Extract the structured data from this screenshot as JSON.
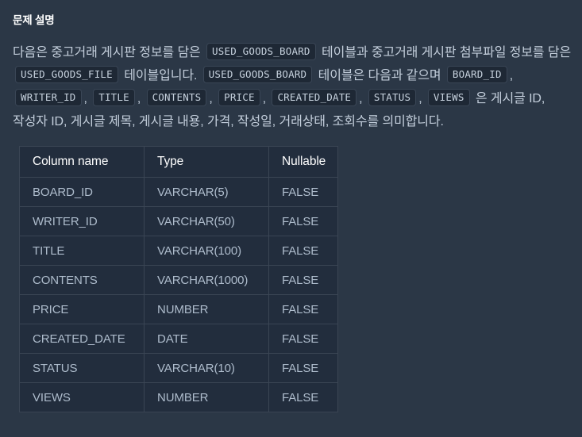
{
  "section": {
    "title": "문제 설명"
  },
  "description": {
    "segments": [
      {
        "type": "text",
        "value": "다음은 중고거래 게시판 정보를 담은 "
      },
      {
        "type": "code",
        "value": "USED_GOODS_BOARD"
      },
      {
        "type": "text",
        "value": " 테이블과 중고거래 게시판 첨부파일 정보를 담은 "
      },
      {
        "type": "code",
        "value": "USED_GOODS_FILE"
      },
      {
        "type": "text",
        "value": " 테이블입니다. "
      },
      {
        "type": "code",
        "value": "USED_GOODS_BOARD"
      },
      {
        "type": "text",
        "value": " 테이블은 다음과 같으며 "
      },
      {
        "type": "code",
        "value": "BOARD_ID"
      },
      {
        "type": "text",
        "value": ", "
      },
      {
        "type": "code",
        "value": "WRITER_ID"
      },
      {
        "type": "text",
        "value": ", "
      },
      {
        "type": "code",
        "value": "TITLE"
      },
      {
        "type": "text",
        "value": ", "
      },
      {
        "type": "code",
        "value": "CONTENTS"
      },
      {
        "type": "text",
        "value": ", "
      },
      {
        "type": "code",
        "value": "PRICE"
      },
      {
        "type": "text",
        "value": ", "
      },
      {
        "type": "code",
        "value": "CREATED_DATE"
      },
      {
        "type": "text",
        "value": ", "
      },
      {
        "type": "code",
        "value": "STATUS"
      },
      {
        "type": "text",
        "value": ", "
      },
      {
        "type": "code",
        "value": "VIEWS"
      },
      {
        "type": "text",
        "value": " 은 게시글 ID, 작성자 ID, 게시글 제목, 게시글 내용, 가격, 작성일, 거래상태, 조회수를 의미합니다."
      }
    ]
  },
  "schema_table": {
    "headers": [
      "Column name",
      "Type",
      "Nullable"
    ],
    "rows": [
      [
        "BOARD_ID",
        "VARCHAR(5)",
        "FALSE"
      ],
      [
        "WRITER_ID",
        "VARCHAR(50)",
        "FALSE"
      ],
      [
        "TITLE",
        "VARCHAR(100)",
        "FALSE"
      ],
      [
        "CONTENTS",
        "VARCHAR(1000)",
        "FALSE"
      ],
      [
        "PRICE",
        "NUMBER",
        "FALSE"
      ],
      [
        "CREATED_DATE",
        "DATE",
        "FALSE"
      ],
      [
        "STATUS",
        "VARCHAR(10)",
        "FALSE"
      ],
      [
        "VIEWS",
        "NUMBER",
        "FALSE"
      ]
    ]
  },
  "colors": {
    "page_background": "#2b3746",
    "table_background": "#222d3d",
    "table_border": "#3a4554",
    "body_text": "#c3cedb",
    "heading_text": "#ffffff",
    "cell_text": "#aebccc",
    "code_background": "#1e2835",
    "code_border": "#3a4656",
    "code_text": "#c7d2de"
  }
}
